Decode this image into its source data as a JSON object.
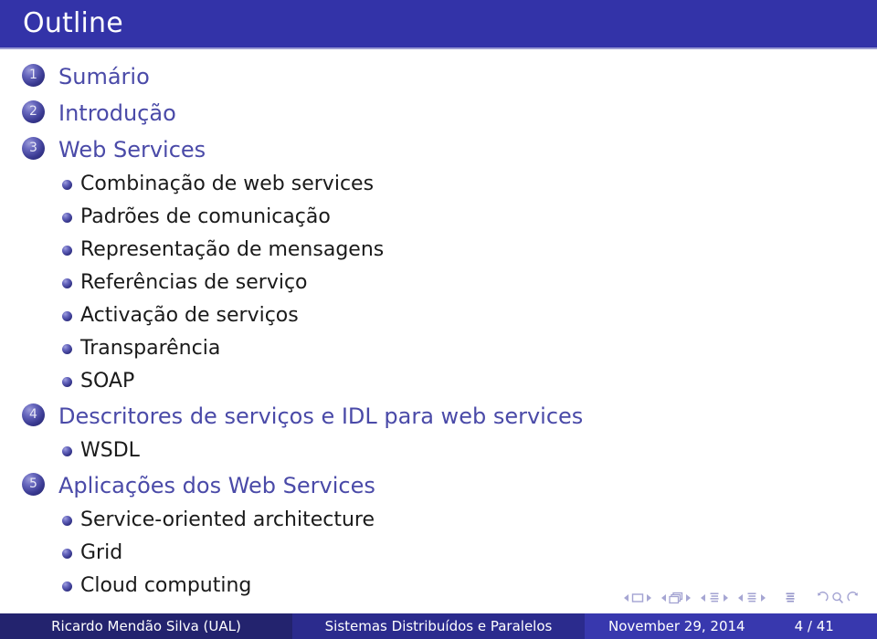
{
  "header": {
    "title": "Outline"
  },
  "outline": {
    "sections": [
      {
        "number": "1",
        "label": "Sumário",
        "subitems": []
      },
      {
        "number": "2",
        "label": "Introdução",
        "subitems": []
      },
      {
        "number": "3",
        "label": "Web Services",
        "subitems": [
          "Combinação de web services",
          "Padrões de comunicação",
          "Representação de mensagens",
          "Referências de serviço",
          "Activação de serviços",
          "Transparência",
          "SOAP"
        ]
      },
      {
        "number": "4",
        "label": "Descritores de serviços e IDL para web services",
        "subitems": [
          "WSDL"
        ]
      },
      {
        "number": "5",
        "label": "Aplicações dos Web Services",
        "subitems": [
          "Service-oriented architecture",
          "Grid",
          "Cloud computing"
        ]
      }
    ]
  },
  "navigation": {
    "groups": [
      {
        "icon": "slide-icon",
        "prev": "previous-slide",
        "next": "next-slide"
      },
      {
        "icon": "frame-stack-icon",
        "prev": "previous-frame",
        "next": "next-frame"
      },
      {
        "icon": "subsection-icon",
        "prev": "previous-subsection",
        "next": "next-subsection"
      },
      {
        "icon": "section-icon",
        "prev": "previous-section",
        "next": "next-section"
      }
    ],
    "document_icon": "document-icon",
    "back_icon": "back-arrow-icon",
    "search_icon": "search-icon",
    "forward_icon": "forward-arrow-icon"
  },
  "footer": {
    "author": "Ricardo Mendão Silva  (UAL)",
    "course": "Sistemas Distribuídos e Paralelos",
    "date": "November 29, 2014",
    "page": "4 / 41"
  },
  "colors": {
    "header_bg": "#3333a8",
    "header_rule": "#9a9ad2",
    "section_text": "#4a4aa8",
    "sub_text": "#1a1a1a",
    "footer_author_bg": "#23236e",
    "footer_course_bg": "#2b2b8d",
    "footer_right_bg": "#3838ae",
    "background": "#ffffff"
  }
}
